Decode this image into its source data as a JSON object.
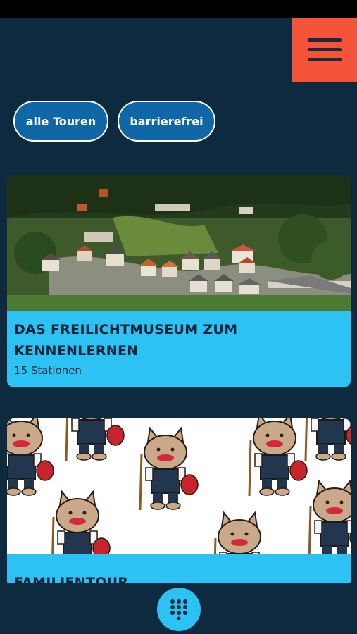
{
  "menu": {
    "icon": "hamburger-menu-icon",
    "color": "#f4533a"
  },
  "filters": [
    {
      "label": "alle Touren"
    },
    {
      "label": "barrierefrei"
    }
  ],
  "tours": [
    {
      "title": "DAS FREILICHTMUSEUM ZUM KENNENLERNEN",
      "subtitle": "15 Stationen",
      "image": "aerial village photo"
    },
    {
      "title": "FAMILIENTOUR",
      "image": "cartoon cat pattern"
    }
  ],
  "bottom": {
    "icon": "dial-pad-icon"
  },
  "colors": {
    "background": "#0d2a3f",
    "accent": "#2cc2f3",
    "filter_fill": "#0f67a7"
  }
}
